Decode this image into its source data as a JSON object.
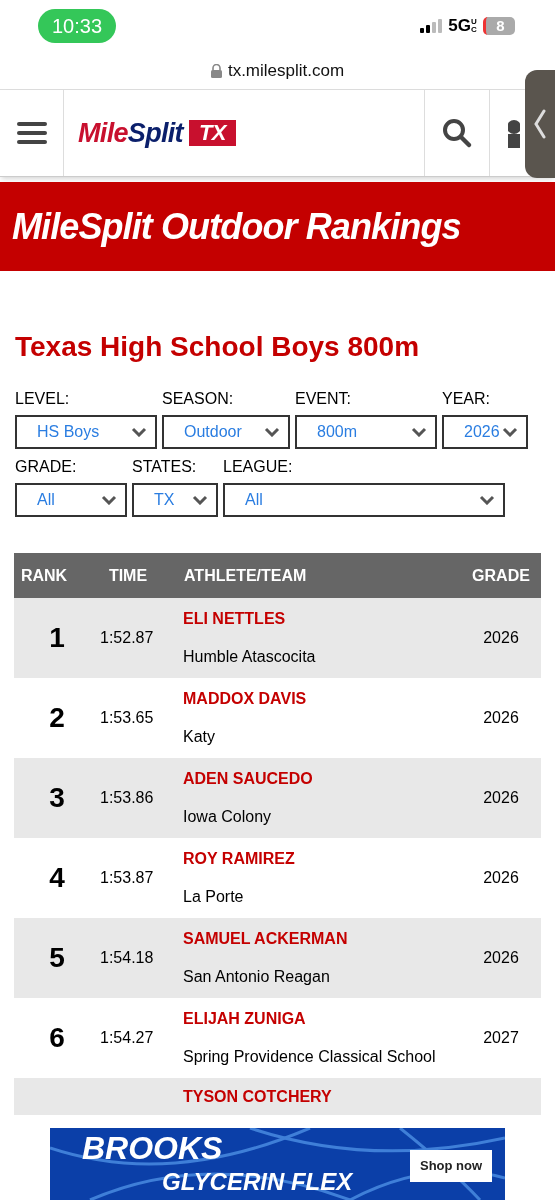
{
  "status_bar": {
    "time": "10:33",
    "network": "5G",
    "network_sub": "UC",
    "battery": "8"
  },
  "url_bar": {
    "url": "tx.milesplit.com"
  },
  "header": {
    "logo_parts": [
      "Mile",
      "Split"
    ],
    "logo_badge": "TX"
  },
  "banner": {
    "title": "MileSplit Outdoor Rankings"
  },
  "page_title": "Texas High School Boys 800m",
  "filters": [
    {
      "label": "LEVEL:",
      "value": "HS Boys"
    },
    {
      "label": "SEASON:",
      "value": "Outdoor"
    },
    {
      "label": "EVENT:",
      "value": "800m"
    },
    {
      "label": "YEAR:",
      "value": "2026"
    },
    {
      "label": "GRADE:",
      "value": "All"
    },
    {
      "label": "STATES:",
      "value": "TX"
    },
    {
      "label": "LEAGUE:",
      "value": "All"
    }
  ],
  "table": {
    "columns": [
      "RANK",
      "TIME",
      "ATHLETE/TEAM",
      "GRADE"
    ],
    "rows": [
      {
        "rank": "1",
        "time": "1:52.87",
        "athlete": "ELI NETTLES",
        "team": "Humble Atascocita",
        "grade": "2026"
      },
      {
        "rank": "2",
        "time": "1:53.65",
        "athlete": "MADDOX DAVIS",
        "team": "Katy",
        "grade": "2026"
      },
      {
        "rank": "3",
        "time": "1:53.86",
        "athlete": "ADEN SAUCEDO",
        "team": "Iowa Colony",
        "grade": "2026"
      },
      {
        "rank": "4",
        "time": "1:53.87",
        "athlete": "ROY RAMIREZ",
        "team": "La Porte",
        "grade": "2026"
      },
      {
        "rank": "5",
        "time": "1:54.18",
        "athlete": "SAMUEL ACKERMAN",
        "team": "San Antonio Reagan",
        "grade": "2026"
      },
      {
        "rank": "6",
        "time": "1:54.27",
        "athlete": "ELIJAH ZUNIGA",
        "team": "Spring Providence Classical School",
        "grade": "2027"
      },
      {
        "athlete": "TYSON COTCHERY"
      }
    ]
  },
  "ad": {
    "brand": "BROOKS",
    "product": "GLYCERIN FLEX",
    "button": "Shop now"
  }
}
